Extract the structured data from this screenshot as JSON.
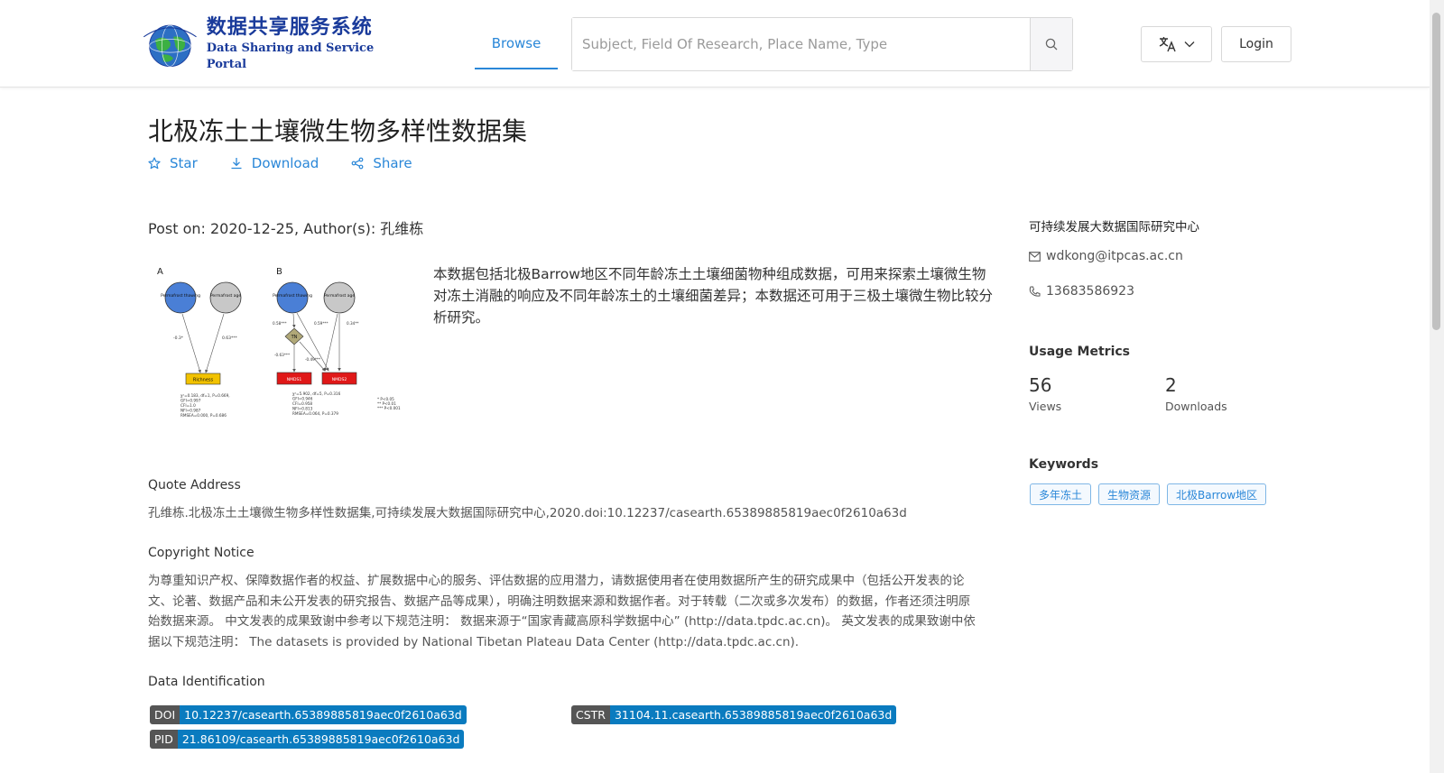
{
  "header": {
    "logo_cn": "数据共享服务系统",
    "logo_en": "Data Sharing and Service Portal",
    "nav_browse": "Browse",
    "search_placeholder": "Subject, Field Of Research, Place Name, Type",
    "login": "Login"
  },
  "dataset": {
    "title": "北极冻土土壤微生物多样性数据集",
    "actions": {
      "star": "Star",
      "download": "Download",
      "share": "Share"
    },
    "post_on": "Post on: 2020-12-25, Author(s): 孔维栋",
    "description": "本数据包括北极Barrow地区不同年龄冻土土壤细菌物种组成数据，可用来探索土壤微生物对冻土消融的响应及不同年龄冻土的土壤细菌差异；本数据还可用于三极土壤微生物比较分析研究。"
  },
  "figure": {
    "panel_a": "A",
    "panel_b": "B",
    "node_thawing": "Permafrost thawing",
    "node_age": "Permafrost age",
    "node_tn": "TN",
    "node_richness": "Richness",
    "node_nmds1": "NMDS1",
    "node_nmds2": "NMDS2",
    "coef_a1": "-0.3*",
    "coef_a2": "0.63***",
    "coef_b1": "0.58***",
    "coef_b2": "0.59***",
    "coef_b3": "0.34**",
    "coef_b4": "-0.63***",
    "coef_b5": "-0.49***",
    "stats_a": [
      "χ²=0.183, df=1, P=0.669,",
      "GFI=0.997",
      "CFI=1.0",
      "NFI=0.987",
      "RMSEA=0.000, P=0.686"
    ],
    "stats_b": [
      "χ²=5.902, df=5, P=0.316",
      "GFI=0.946",
      "CFI=0.958",
      "NFI=0.813",
      "RMSEA=0.064, P=0.379"
    ],
    "legend": [
      "*    P<0.05",
      "**   P<0.01",
      "***  P<0.001"
    ]
  },
  "quote": {
    "heading": "Quote Address",
    "text": "孔维栋.北极冻土土壤微生物多样性数据集,可持续发展大数据国际研究中心,2020.doi:10.12237/casearth.65389885819aec0f2610a63d"
  },
  "copyright": {
    "heading": "Copyright Notice",
    "text": "为尊重知识产权、保障数据作者的权益、扩展数据中心的服务、评估数据的应用潜力，请数据使用者在使用数据所产生的研究成果中（包括公开发表的论文、论著、数据产品和未公开发表的研究报告、数据产品等成果），明确注明数据来源和数据作者。对于转载（二次或多次发布）的数据，作者还须注明原始数据来源。 中文发表的成果致谢中参考以下规范注明： 数据来源于“国家青藏高原科学数据中心” (http://data.tpdc.ac.cn)。 英文发表的成果致谢中依据以下规范注明： The datasets is provided by National Tibetan Plateau Data Center (http://data.tpdc.ac.cn)."
  },
  "identification": {
    "heading": "Data Identification",
    "doi_key": "DOI",
    "doi_val": "10.12237/casearth.65389885819aec0f2610a63d",
    "cstr_key": "CSTR",
    "cstr_val": "31104.11.casearth.65389885819aec0f2610a63d",
    "pid_key": "PID",
    "pid_val": "21.86109/casearth.65389885819aec0f2610a63d"
  },
  "sidebar": {
    "organization": "可持续发展大数据国际研究中心",
    "email": "wdkong@itpcas.ac.cn",
    "phone": "13683586923",
    "metrics_heading": "Usage Metrics",
    "views_value": "56",
    "views_label": "Views",
    "downloads_value": "2",
    "downloads_label": "Downloads",
    "keywords_heading": "Keywords",
    "keywords": [
      "多年冻土",
      "生物资源",
      "北极Barrow地区"
    ]
  },
  "colors": {
    "accent": "#2a87d8",
    "badge_key": "#555555",
    "badge_value": "#0a7bbf",
    "logo_blue": "#1a3b9b"
  },
  "icons": {
    "search": "search-icon",
    "language": "translate-icon",
    "star": "star-icon",
    "download": "download-icon",
    "share": "share-icon",
    "email": "mail-icon",
    "phone": "phone-icon"
  }
}
